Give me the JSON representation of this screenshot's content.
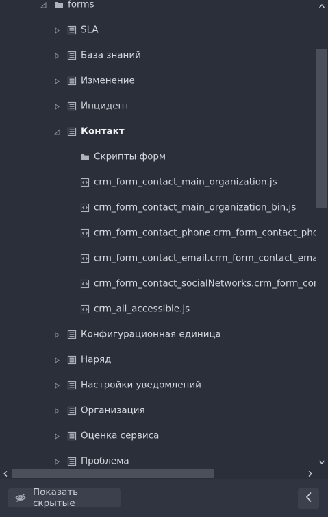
{
  "tree": {
    "items": [
      {
        "label": "forms",
        "icon": "folder-icon",
        "arrow": "expanded",
        "bold": false
      },
      {
        "label": "SLA",
        "icon": "form-icon",
        "arrow": "collapsed",
        "bold": false
      },
      {
        "label": "База знаний",
        "icon": "form-icon",
        "arrow": "collapsed",
        "bold": false
      },
      {
        "label": "Изменение",
        "icon": "form-icon",
        "arrow": "collapsed",
        "bold": false
      },
      {
        "label": "Инцидент",
        "icon": "form-icon",
        "arrow": "collapsed",
        "bold": false
      },
      {
        "label": "Контакт",
        "icon": "form-icon",
        "arrow": "expanded",
        "bold": true
      },
      {
        "label": "Скрипты форм",
        "icon": "folder-icon",
        "arrow": "none",
        "bold": false
      },
      {
        "label": "crm_form_contact_main_organization.js",
        "icon": "script-file-icon",
        "arrow": "none",
        "bold": false
      },
      {
        "label": "crm_form_contact_main_organization_bin.js",
        "icon": "script-file-icon",
        "arrow": "none",
        "bold": false
      },
      {
        "label": "crm_form_contact_phone.crm_form_contact_phone",
        "icon": "script-file-icon",
        "arrow": "none",
        "bold": false
      },
      {
        "label": "crm_form_contact_email.crm_form_contact_email_c",
        "icon": "script-file-icon",
        "arrow": "none",
        "bold": false
      },
      {
        "label": "crm_form_contact_socialNetworks.crm_form_contac",
        "icon": "script-file-icon",
        "arrow": "none",
        "bold": false
      },
      {
        "label": "crm_all_accessible.js",
        "icon": "script-file-icon",
        "arrow": "none",
        "bold": false
      },
      {
        "label": "Конфигурационная единица",
        "icon": "form-icon",
        "arrow": "collapsed",
        "bold": false
      },
      {
        "label": "Наряд",
        "icon": "form-icon",
        "arrow": "collapsed",
        "bold": false
      },
      {
        "label": "Настройки уведомлений",
        "icon": "form-icon",
        "arrow": "collapsed",
        "bold": false
      },
      {
        "label": "Организация",
        "icon": "form-icon",
        "arrow": "collapsed",
        "bold": false
      },
      {
        "label": "Оценка сервиса",
        "icon": "form-icon",
        "arrow": "collapsed",
        "bold": false
      },
      {
        "label": "Проблема",
        "icon": "form-icon",
        "arrow": "collapsed",
        "bold": false
      }
    ]
  },
  "bottom": {
    "show_hidden_label": "Показать скрытые",
    "show_hidden_icon": "eye-slash-icon",
    "collapse_icon": "chevron-left-icon"
  },
  "colors": {
    "background": "#2b2f3a",
    "text": "#d3d7de",
    "icon": "#aeb3bc",
    "scroll_thumb": "#4a4f5a"
  }
}
